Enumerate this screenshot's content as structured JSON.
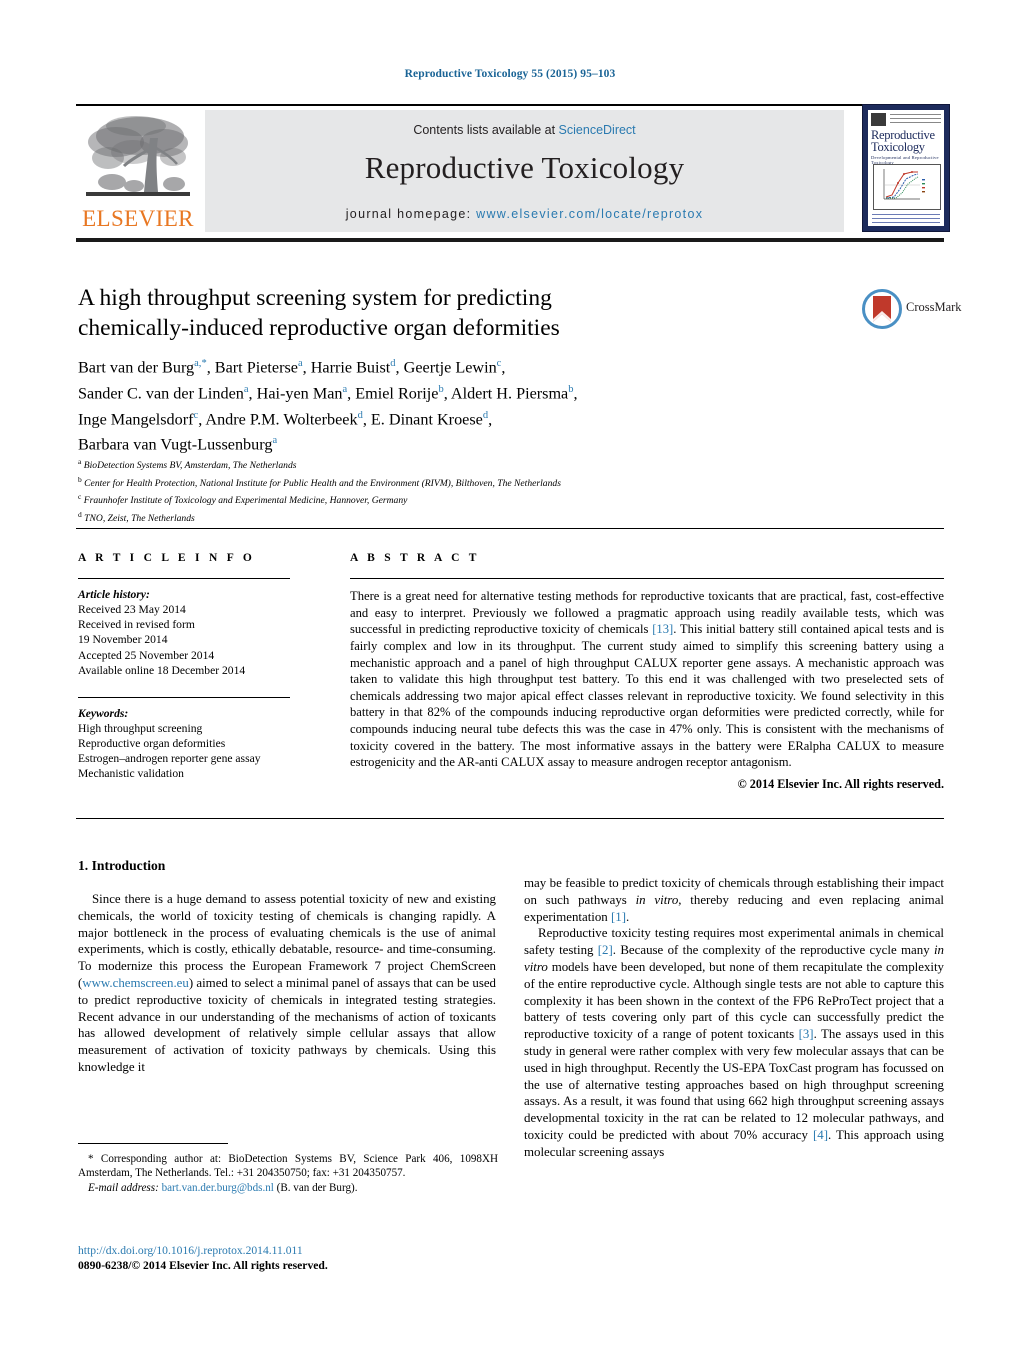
{
  "running_head": "Reproductive Toxicology 55 (2015) 95–103",
  "masthead": {
    "publisher_name": "ELSEVIER",
    "contents_prefix": "Contents lists available at ",
    "sciencedirect": "ScienceDirect",
    "journal_title": "Reproductive Toxicology",
    "homepage_prefix": "journal homepage: ",
    "homepage_url": "www.elsevier.com/locate/reprotox",
    "cover": {
      "title_line1": "Reproductive",
      "title_line2": "Toxicology",
      "subtitle": "Developmental and Reproductive Toxicology"
    }
  },
  "article": {
    "title_line1": "A high throughput screening system for predicting",
    "title_line2": "chemically-induced reproductive organ deformities",
    "crossmark_label": "CrossMark",
    "authors_html": "Bart van der Burg<sup>a,<span class=\"star\">*</span></sup>, Bart Pieterse<sup>a</sup>, Harrie Buist<sup>d</sup>, Geertje Lewin<sup>c</sup>,<br>Sander C. van der Linden<sup>a</sup>, Hai-yen Man<sup>a</sup>, Emiel Rorije<sup>b</sup>, Aldert H. Piersma<sup>b</sup>,<br>Inge Mangelsdorf<sup>c</sup>, Andre P.M. Wolterbeek<sup>d</sup>, E. Dinant Kroese<sup>d</sup>,<br>Barbara van Vugt-Lussenburg<sup>a</sup>",
    "affiliations": [
      {
        "marker": "a",
        "text": "BioDetection Systems BV, Amsterdam, The Netherlands"
      },
      {
        "marker": "b",
        "text": "Center for Health Protection, National Institute for Public Health and the Environment (RIVM), Bilthoven, The Netherlands"
      },
      {
        "marker": "c",
        "text": "Fraunhofer Institute of Toxicology and Experimental Medicine, Hannover, Germany"
      },
      {
        "marker": "d",
        "text": "TNO, Zeist, The Netherlands"
      }
    ]
  },
  "article_info": {
    "heading": "A R T I C L E   I N F O",
    "history_label": "Article history:",
    "history": [
      "Received 23 May 2014",
      "Received in revised form",
      "19 November 2014",
      "Accepted 25 November 2014",
      "Available online 18 December 2014"
    ],
    "keywords_label": "Keywords:",
    "keywords": [
      "High throughput screening",
      "Reproductive organ deformities",
      "Estrogen–androgen reporter gene assay",
      "Mechanistic validation"
    ]
  },
  "abstract": {
    "heading": "A B S T R A C T",
    "body_html": "There is a great need for alternative testing methods for reproductive toxicants that are practical, fast, cost-effective and easy to interpret. Previously we followed a pragmatic approach using readily available tests, which was successful in predicting reproductive toxicity of chemicals <span class=\"ref\">[13]</span>. This initial battery still contained apical tests and is fairly complex and low in its throughput. The current study aimed to simplify this screening battery using a mechanistic approach and a panel of high throughput CALUX reporter gene assays. A mechanistic approach was taken to validate this high throughput test battery. To this end it was challenged with two preselected sets of chemicals addressing two major apical effect classes relevant in reproductive toxicity. We found selectivity in this battery in that 82% of the compounds inducing reproductive organ deformities were predicted correctly, while for compounds inducing neural tube defects this was the case in 47% only. This is consistent with the mechanisms of toxicity covered in the battery. The most informative assays in the battery were ERalpha CALUX to measure estrogenicity and the AR-anti CALUX assay to measure androgen receptor antagonism.",
    "copyright": "© 2014 Elsevier Inc. All rights reserved."
  },
  "body": {
    "section_number_title": "1.  Introduction",
    "left_paragraph_html": "Since there is a huge demand to assess potential toxicity of new and existing chemicals, the world of toxicity testing of chemicals is changing rapidly. A major bottleneck in the process of evaluating chemicals is the use of animal experiments, which is costly, ethically debatable, resource- and time-consuming. To modernize this process the European Framework 7 project ChemScreen (<span class=\"lnk\">www.chemscreen.eu</span>) aimed to select a minimal panel of assays that can be used to predict reproductive toxicity of chemicals in integrated testing strategies. Recent advance in our understanding of the mechanisms of action of toxicants has allowed development of relatively simple cellular assays that allow measurement of activation of toxicity pathways by chemicals. Using this knowledge it",
    "right_paragraph1_html": "may be feasible to predict toxicity of chemicals through establishing their impact on such pathways <span class=\"it\">in vitro</span>, thereby reducing and even replacing animal experimentation <span class=\"ref\">[1]</span>.",
    "right_paragraph2_html": "Reproductive toxicity testing requires most experimental animals in chemical safety testing <span class=\"ref\">[2]</span>. Because of the complexity of the reproductive cycle many <span class=\"it\">in vitro</span> models have been developed, but none of them recapitulate the complexity of the entire reproductive cycle. Although single tests are not able to capture this complexity it has been shown in the context of the FP6 ReProTect project that a battery of tests covering only part of this cycle can successfully predict the reproductive toxicity of a range of potent toxicants <span class=\"ref\">[3]</span>. The assays used in this study in general were rather complex with very few molecular assays that can be used in high throughput. Recently the US-EPA ToxCast program has focussed on the use of alternative testing approaches based on high throughput screening assays. As a result, it was found that using 662 high throughput screening assays developmental toxicity in the rat can be related to 12 molecular pathways, and toxicity could be predicted with about 70% accuracy <span class=\"ref\">[4]</span>. This approach using molecular screening assays"
  },
  "footnote": {
    "corresponding_html": "* Corresponding author at: BioDetection Systems BV, Science Park 406, 1098XH Amsterdam, The Netherlands. Tel.: +31 204350750; fax: +31 204350757.",
    "email_html": "<span class=\"it\">E-mail address:</span> <span class=\"lnk\">bart.van.der.burg@bds.nl</span> (B. van der Burg)."
  },
  "doi": {
    "url": "http://dx.doi.org/10.1016/j.reprotox.2014.11.011",
    "issn_line": "0890-6238/© 2014 Elsevier Inc. All rights reserved."
  },
  "colors": {
    "link": "#2a7ab0",
    "elsevier_orange": "#E87722",
    "masthead_gray": "#e6e7e8",
    "cover_navy": "#1d2b5c"
  }
}
